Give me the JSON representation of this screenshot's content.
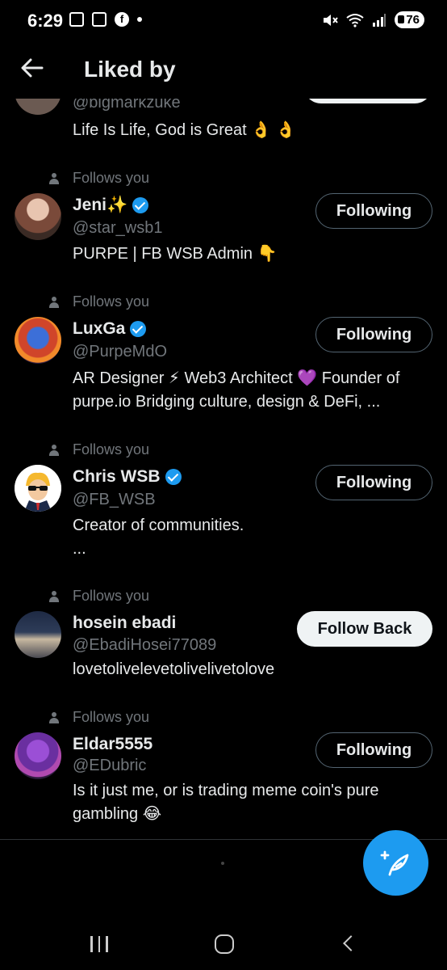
{
  "status_bar": {
    "time": "6:29",
    "battery": "76"
  },
  "header": {
    "title": "Liked by"
  },
  "partial_user": {
    "handle": "@bigmarkzuke",
    "bio": "Life Is Life, God is Great 👌 👌"
  },
  "users": [
    {
      "follows_label": "Follows you",
      "name": "Jeni✨",
      "verified": true,
      "handle": "@star_wsb1",
      "bio": "PURPE | FB WSB Admin 👇",
      "button": "Following"
    },
    {
      "follows_label": "Follows you",
      "name": "LuxGa",
      "verified": true,
      "handle": "@PurpeMdO",
      "bio": "AR Designer ⚡ Web3 Architect 💜 Founder of purpe.io Bridging culture, design & DeFi,  ...",
      "button": "Following"
    },
    {
      "follows_label": "Follows you",
      "name": "Chris WSB",
      "verified": true,
      "handle": "@FB_WSB",
      "bio": "Creator of communities.\n...",
      "button": "Following"
    },
    {
      "follows_label": "Follows you",
      "name": "hosein ebadi",
      "verified": false,
      "handle": "@EbadiHosei77089",
      "bio": "lovetolivelevetolivelivetolove",
      "button": "Follow Back"
    },
    {
      "follows_label": "Follows you",
      "name": "Eldar5555",
      "verified": false,
      "handle": "@EDubric",
      "bio": "Is it just me, or is trading meme coin's pure gambling 😂",
      "button": "Following"
    }
  ],
  "colors": {
    "accent": "#1d9bf0",
    "background": "#000000",
    "secondary_text": "#71767b"
  },
  "icons": {
    "back": "arrow-left-icon",
    "compose": "compose-post-icon",
    "verified": "verified-badge-icon"
  }
}
